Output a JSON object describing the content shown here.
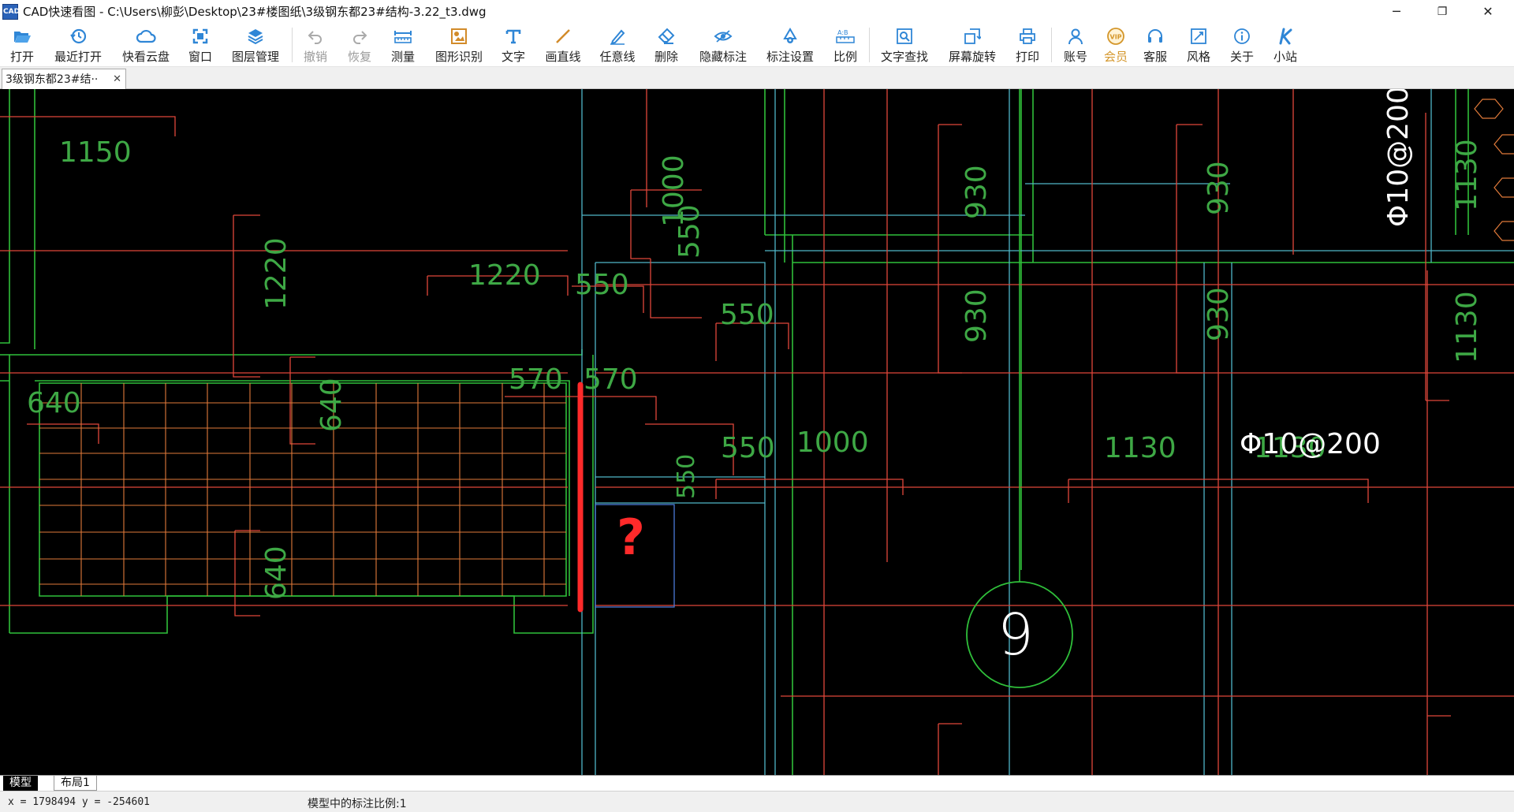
{
  "window": {
    "icon_text": "CAD",
    "title": "CAD快速看图 - C:\\Users\\柳彭\\Desktop\\23#楼图纸\\3级钢东都23#结构-3.22_t3.dwg",
    "minimize": "─",
    "restore": "❐",
    "close": "✕"
  },
  "toolbar": {
    "items": [
      {
        "label": "打开",
        "icon": "folder-open-icon"
      },
      {
        "label": "最近打开",
        "icon": "recent-clock-icon"
      },
      {
        "label": "快看云盘",
        "icon": "cloud-icon"
      },
      {
        "label": "窗口",
        "icon": "window-icon"
      },
      {
        "label": "图层管理",
        "icon": "layers-icon"
      },
      {
        "label": "撤销",
        "icon": "undo-icon"
      },
      {
        "label": "恢复",
        "icon": "redo-icon"
      },
      {
        "label": "测量",
        "icon": "ruler-icon"
      },
      {
        "label": "图形识别",
        "icon": "shape-recognize-icon"
      },
      {
        "label": "文字",
        "icon": "text-icon"
      },
      {
        "label": "画直线",
        "icon": "line-icon"
      },
      {
        "label": "任意线",
        "icon": "pen-icon"
      },
      {
        "label": "删除",
        "icon": "eraser-icon"
      },
      {
        "label": "隐藏标注",
        "icon": "eye-icon"
      },
      {
        "label": "标注设置",
        "icon": "annotation-settings-icon"
      },
      {
        "label": "比例",
        "icon": "scale-icon"
      },
      {
        "label": "文字查找",
        "icon": "text-search-icon"
      },
      {
        "label": "屏幕旋转",
        "icon": "rotate-screen-icon"
      },
      {
        "label": "打印",
        "icon": "printer-icon"
      },
      {
        "label": "账号",
        "icon": "user-icon"
      },
      {
        "label": "会员",
        "icon": "vip-icon"
      },
      {
        "label": "客服",
        "icon": "headset-icon"
      },
      {
        "label": "风格",
        "icon": "style-icon"
      },
      {
        "label": "关于",
        "icon": "info-icon"
      },
      {
        "label": "小站",
        "icon": "k-logo-icon"
      }
    ]
  },
  "document_tab": {
    "label": "3级钢东都23#结··",
    "close": "✕"
  },
  "drawing": {
    "texts": [
      "1150",
      "1220",
      "1220",
      "550",
      "550",
      "550",
      "550",
      "570",
      "570",
      "640",
      "640",
      "640",
      "1000",
      "1000",
      "930",
      "930",
      "930",
      "930",
      "1130",
      "1130",
      "1130",
      "1130",
      "Φ10@200",
      "Φ10@200",
      "550",
      "9"
    ],
    "annotation_mark": "?"
  },
  "layout_tabs": {
    "model": "模型",
    "layout1": "布局1"
  },
  "status": {
    "coords": "x = 1798494  y = -254601",
    "scale": "模型中的标注比例:1"
  },
  "colors": {
    "canvas_bg": "#000000",
    "red_line": "#e0463a",
    "green_line": "#2fbf3a",
    "cyan_line": "#4fb6c8",
    "dim_text": "#3ea845",
    "annotation_red": "#ff2a2a",
    "toolbar_icon_blue": "#2f86d6"
  }
}
